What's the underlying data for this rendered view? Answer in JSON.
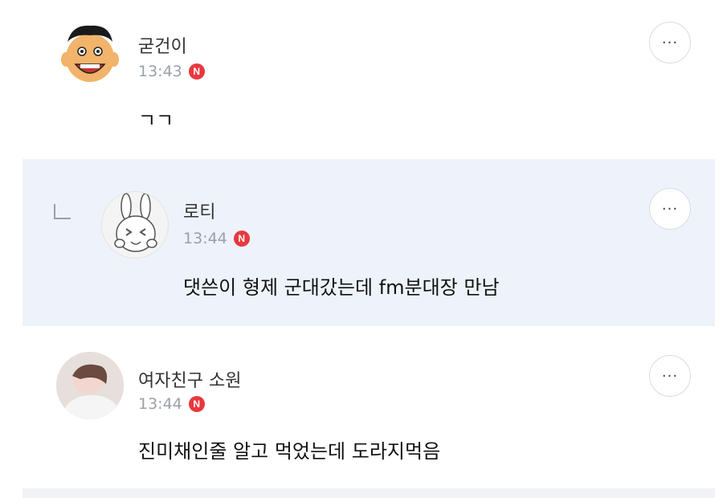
{
  "comments": [
    {
      "author": "굳건이",
      "time": "13:43",
      "badge": "N",
      "text": "ㄱㄱ",
      "more_icon": "···"
    },
    {
      "author": "로티",
      "time": "13:44",
      "badge": "N",
      "text": "댓쓴이 형제 군대갔는데 fm분대장 만남",
      "more_icon": "···",
      "is_reply": true
    },
    {
      "author": "여자친구 소원",
      "time": "13:44",
      "badge": "N",
      "text": "진미채인줄 알고 먹었는데 도라지먹음",
      "more_icon": "···"
    }
  ],
  "colors": {
    "reply_background": "#eef3fb",
    "badge": "#e8383d",
    "timestamp": "#9aa0a8"
  }
}
